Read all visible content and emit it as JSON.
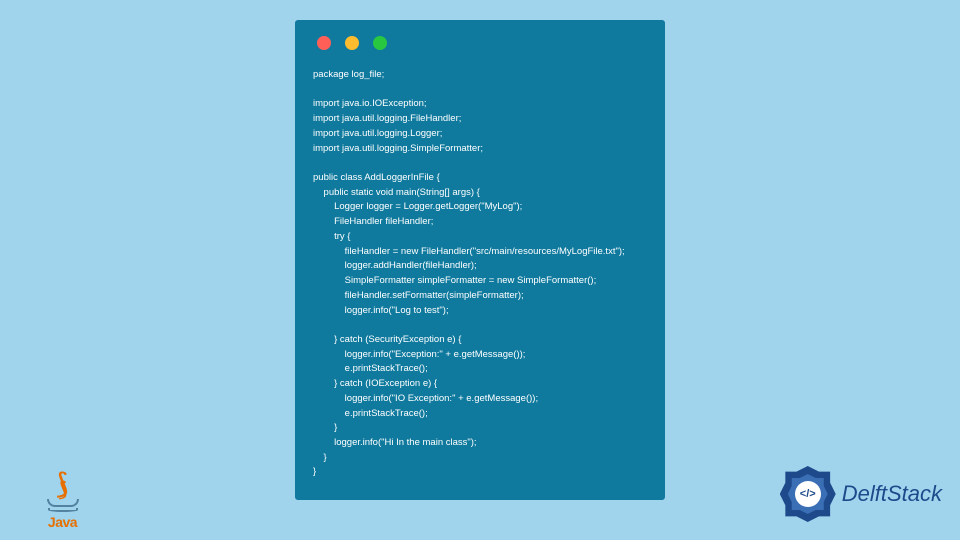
{
  "code": {
    "lines": [
      "package log_file;",
      "",
      "import java.io.IOException;",
      "import java.util.logging.FileHandler;",
      "import java.util.logging.Logger;",
      "import java.util.logging.SimpleFormatter;",
      "",
      "public class AddLoggerInFile {",
      "    public static void main(String[] args) {",
      "        Logger logger = Logger.getLogger(\"MyLog\");",
      "        FileHandler fileHandler;",
      "        try {",
      "            fileHandler = new FileHandler(\"src/main/resources/MyLogFile.txt\");",
      "            logger.addHandler(fileHandler);",
      "            SimpleFormatter simpleFormatter = new SimpleFormatter();",
      "            fileHandler.setFormatter(simpleFormatter);",
      "            logger.info(\"Log to test\");",
      "",
      "        } catch (SecurityException e) {",
      "            logger.info(\"Exception:\" + e.getMessage());",
      "            e.printStackTrace();",
      "        } catch (IOException e) {",
      "            logger.info(\"IO Exception:\" + e.getMessage());",
      "            e.printStackTrace();",
      "        }",
      "        logger.info(\"Hi In the main class\");",
      "    }",
      "}"
    ]
  },
  "java": {
    "label": "Java"
  },
  "delftstack": {
    "symbol": "</>",
    "label": "DelftStack"
  }
}
